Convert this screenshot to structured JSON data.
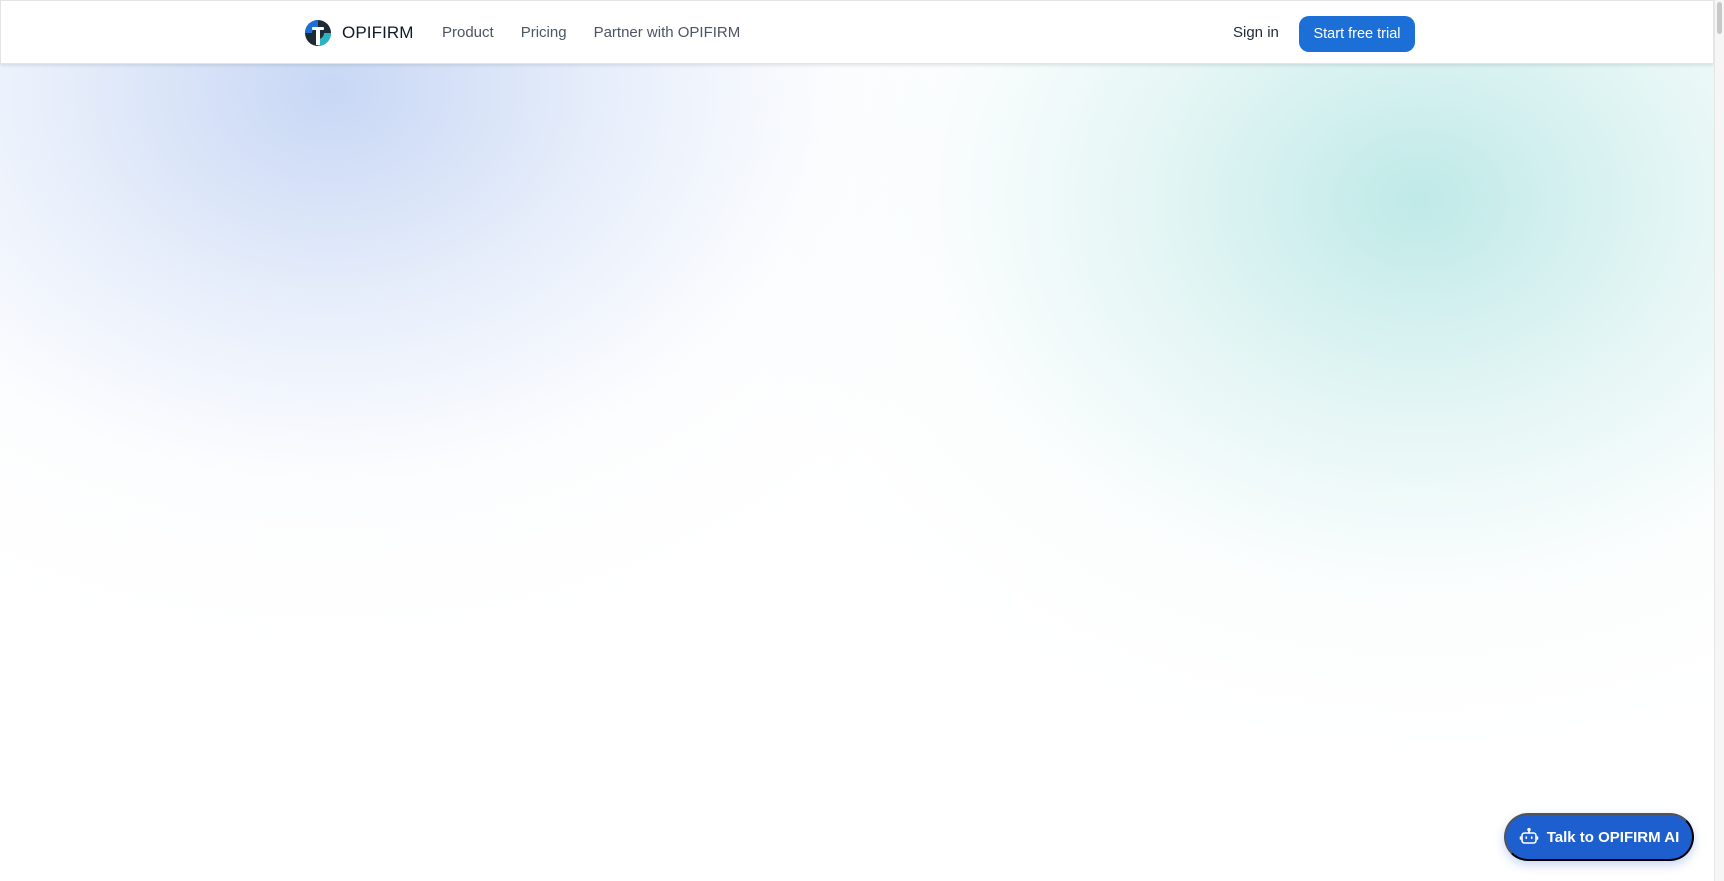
{
  "brand": {
    "name": "OPIFIRM",
    "logo_icon": "opifirm-logo-icon"
  },
  "nav": {
    "items": [
      {
        "label": "Product"
      },
      {
        "label": "Pricing"
      },
      {
        "label": "Partner with OPIFIRM"
      }
    ]
  },
  "header_actions": {
    "signin_label": "Sign in",
    "trial_label": "Start free trial"
  },
  "chat_widget": {
    "label": "Talk to OPIFIRM AI",
    "icon": "robot-icon"
  },
  "colors": {
    "primary": "#1d6fd8",
    "chat_button": "#1d5fcf",
    "nav_text": "#4b5563",
    "gradient_blue": "#bed0f3",
    "gradient_teal": "#afe4e2"
  }
}
